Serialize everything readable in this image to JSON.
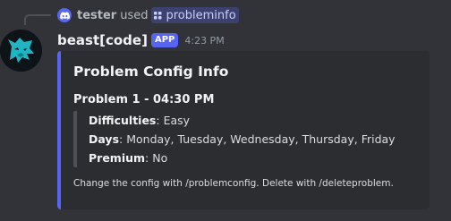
{
  "reply": {
    "user": "tester",
    "used_text": "used",
    "command": "probleminfo"
  },
  "message": {
    "username": "beast[code]",
    "app_tag": "APP",
    "timestamp": "4:23 PM"
  },
  "embed": {
    "title": "Problem Config Info",
    "problem_heading": "Problem 1 - 04:30 PM",
    "fields": [
      {
        "label": "Difficulties",
        "separator": ":",
        "value": " Easy"
      },
      {
        "label": "Days",
        "separator": ":",
        "value": " Monday, Tuesday, Wednesday, Thursday, Friday"
      },
      {
        "label": "Premium",
        "separator": ":",
        "value": " No"
      }
    ],
    "footer": "Change the config with /problemconfig. Delete with /deleteproblem."
  },
  "colors": {
    "accent": "#5865f2",
    "background": "#313338",
    "embed_bg": "#2b2d31"
  },
  "icons": {
    "reply_avatar": "discord-logo-icon",
    "command": "slash-command-icon",
    "bot_avatar": "wolf-logo-icon"
  }
}
